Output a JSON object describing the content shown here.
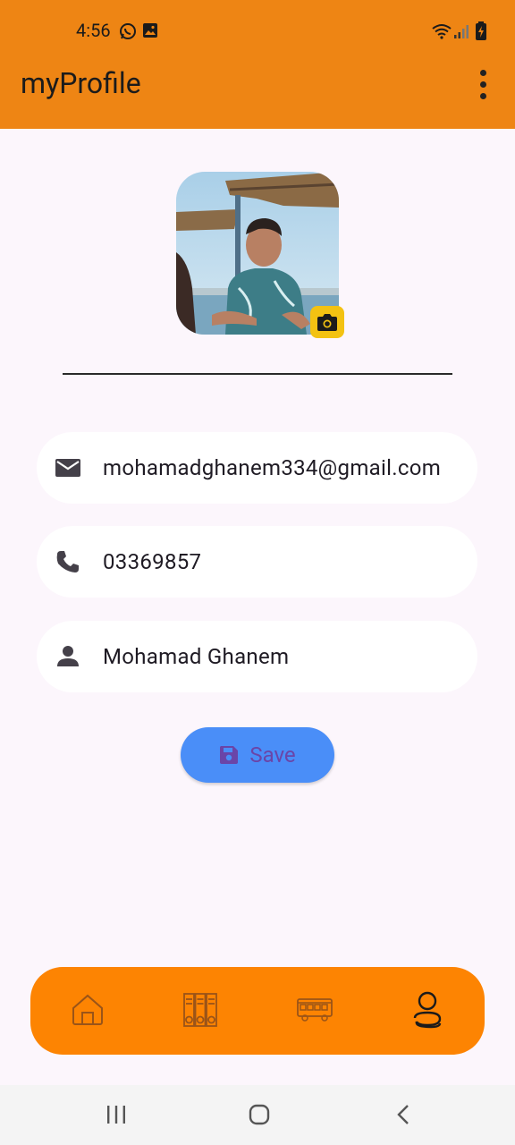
{
  "status_bar": {
    "time": "4:56"
  },
  "app_bar": {
    "title": "myProfile"
  },
  "profile": {
    "email": "mohamadghanem334@gmail.com",
    "phone": "03369857",
    "name": "Mohamad Ghanem"
  },
  "save_button": {
    "label": "Save"
  },
  "colors": {
    "app_bar": "#ee8514",
    "bottom_nav": "#fd8402",
    "save_button": "#4a8ef8",
    "camera_badge": "#f3c212",
    "background": "#fcf6fc"
  },
  "bottom_nav": {
    "items": [
      {
        "icon": "home-icon",
        "active": false
      },
      {
        "icon": "library-icon",
        "active": false
      },
      {
        "icon": "bus-icon",
        "active": false
      },
      {
        "icon": "profile-icon",
        "active": true
      }
    ]
  },
  "system_nav": {
    "icons": [
      "recent-apps-icon",
      "home-circle-icon",
      "back-icon"
    ]
  }
}
